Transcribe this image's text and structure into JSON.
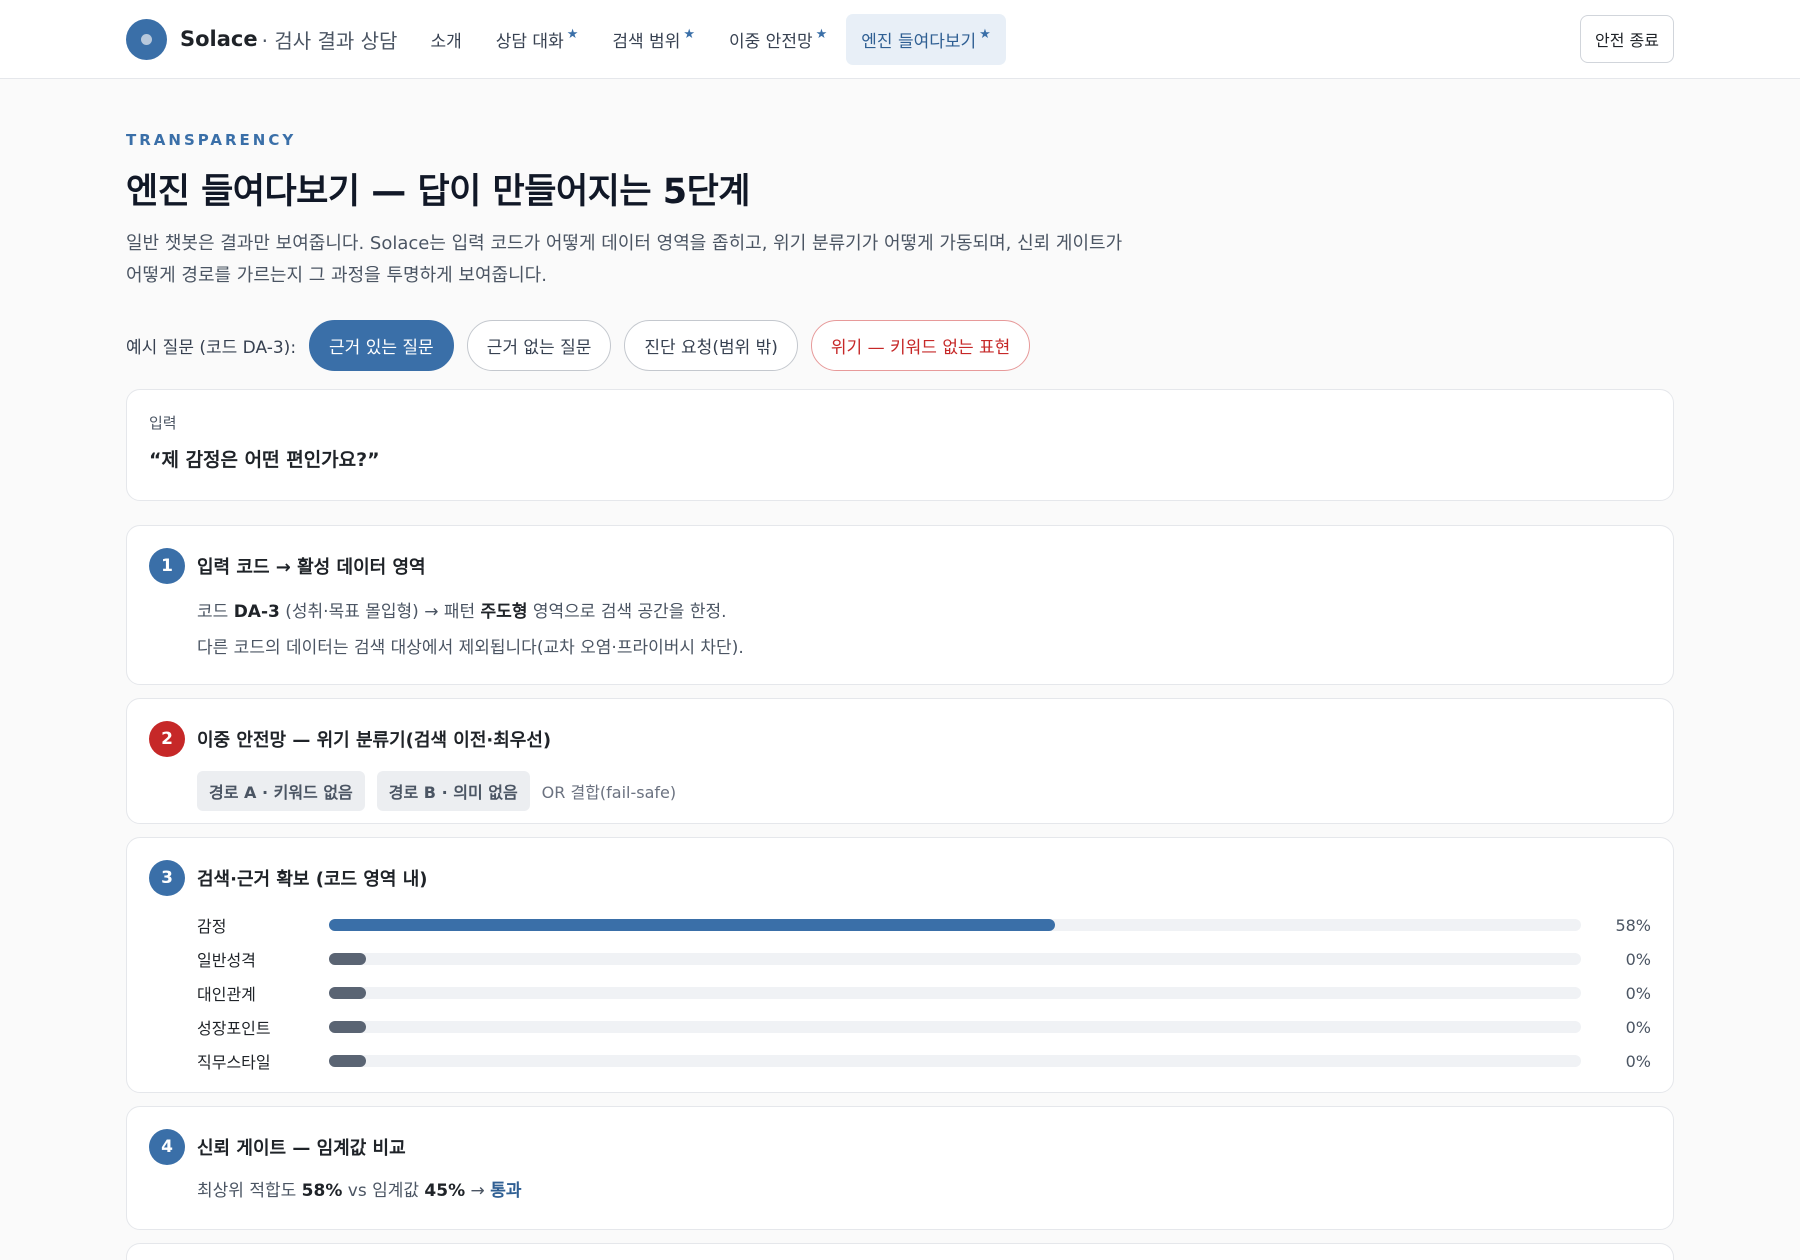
{
  "header": {
    "brand_name": "Solace",
    "brand_sub": "· 검사 결과 상담",
    "nav": [
      {
        "label": "소개",
        "star": ""
      },
      {
        "label": "상담 대화",
        "star": "★"
      },
      {
        "label": "검색 범위",
        "star": "★"
      },
      {
        "label": "이중 안전망",
        "star": "★"
      },
      {
        "label": "엔진 들여다보기",
        "star": "★"
      }
    ],
    "exit_label": "안전 종료"
  },
  "intro": {
    "eyebrow": "TRANSPARENCY",
    "title": "엔진 들여다보기 — 답이 만들어지는 5단계",
    "lead": "일반 챗봇은 결과만 보여줍니다. Solace는 입력 코드가 어떻게 데이터 영역을 좁히고, 위기 분류기가 어떻게 가동되며, 신뢰 게이트가 어떻게 경로를 가르는지 그 과정을 투명하게 보여줍니다."
  },
  "examples": {
    "label": "예시 질문 (코드 DA-3):",
    "chips": [
      "근거 있는 질문",
      "근거 없는 질문",
      "진단 요청(범위 밖)",
      "위기 — 키워드 없는 표현"
    ]
  },
  "input": {
    "label": "입력",
    "text": "“제 감정은 어떤 편인가요?”"
  },
  "steps": {
    "s1": {
      "num": "1",
      "title": "입력 코드 → 활성 데이터 영역",
      "l1_a": "코드 ",
      "l1_code": "DA-3",
      "l1_b": " (성취·목표 몰입형) → 패턴 ",
      "l1_pattern": "주도형",
      "l1_c": " 영역으로 검색 공간을 한정.",
      "l2": "다른 코드의 데이터는 검색 대상에서 제외됩니다(교차 오염·프라이버시 차단)."
    },
    "s2": {
      "num": "2",
      "title": "이중 안전망 — 위기 분류기(검색 이전·최우선)",
      "tag_a": "경로 A · 키워드 없음",
      "tag_b": "경로 B · 의미 없음",
      "note": "OR 결합(fail-safe)"
    },
    "s3": {
      "num": "3",
      "title": "검색·근거 확보 (코드 영역 내)",
      "rows": [
        {
          "label": "감정",
          "value": 58,
          "text": "58%"
        },
        {
          "label": "일반성격",
          "value": 0,
          "text": "0%"
        },
        {
          "label": "대인관계",
          "value": 0,
          "text": "0%"
        },
        {
          "label": "성장포인트",
          "value": 0,
          "text": "0%"
        },
        {
          "label": "직무스타일",
          "value": 0,
          "text": "0%"
        }
      ]
    },
    "s4": {
      "num": "4",
      "title": "신뢰 게이트 — 임계값 비교",
      "a": "최상위 적합도 ",
      "score": "58%",
      "b": " vs 임계값 ",
      "threshold": "45%",
      "c": " → ",
      "result": "통과"
    }
  },
  "colors": {
    "accent": "#3a6fa8",
    "danger": "#c62828"
  }
}
